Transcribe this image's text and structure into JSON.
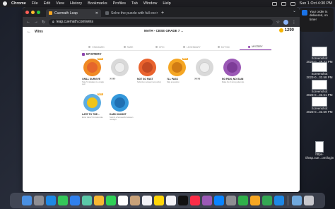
{
  "menubar": {
    "app_name": "Chrome",
    "items": [
      "File",
      "Edit",
      "View",
      "History",
      "Bookmarks",
      "Profiles",
      "Tab",
      "Window",
      "Help"
    ],
    "clock": "Sun 1 Oct  4:30 PM"
  },
  "browser": {
    "tabs": [
      {
        "title": "Cuemath Leap",
        "active": true,
        "favicon_color": "#f5a623"
      },
      {
        "title": "Solve the puzzle with full exc",
        "active": false,
        "favicon_color": "#5f6368"
      }
    ],
    "url": "leap.cuemath.com/wins"
  },
  "page": {
    "header_title": "Wins",
    "grade_selector": "MATH - CBSE GRADE 7",
    "coins": "1290",
    "category_tabs": [
      {
        "label": "STANDARD",
        "active": false
      },
      {
        "label": "RARE",
        "active": false
      },
      {
        "label": "EPIC",
        "active": false
      },
      {
        "label": "LEGENDARY",
        "active": false
      },
      {
        "label": "MYTHIC",
        "active": false
      },
      {
        "label": "MYSTERY",
        "active": true
      }
    ],
    "section_title": "MYSTERY",
    "badges": [
      {
        "name": "I WILL SURVIVE",
        "desc": "Take 5 mistakes in a single quiz",
        "unlocked": true,
        "new": true,
        "color": "#f08a24",
        "inner": "#e5662b"
      },
      {
        "name": "????",
        "desc": "",
        "unlocked": false,
        "new": false,
        "color": "#d9d9d9",
        "inner": "#eeeeee"
      },
      {
        "name": "NOT SO FAST",
        "desc": "Submit an answer too quickly",
        "unlocked": true,
        "new": false,
        "color": "#e9632e",
        "inner": "#c44a23"
      },
      {
        "name": "I'LL PASS",
        "desc": "Skip a question",
        "unlocked": true,
        "new": true,
        "color": "#f5a623",
        "inner": "#d17c14"
      },
      {
        "name": "????",
        "desc": "",
        "unlocked": false,
        "new": false,
        "color": "#d9d9d9",
        "inner": "#eeeeee"
      },
      {
        "name": "NO PAIN, NO GAIN",
        "desc": "Make the 3 wrong attempts",
        "unlocked": true,
        "new": false,
        "color": "#9b59b6",
        "inner": "#7d3c98"
      },
      {
        "name": "LATE TO THE...",
        "desc": "Enter class 5 minutes late",
        "unlocked": true,
        "new": true,
        "color": "#5dade2",
        "inner": "#f0c419"
      },
      {
        "name": "DARK KNIGHT",
        "desc": "Submit a homework between midnight",
        "unlocked": true,
        "new": false,
        "color": "#3498db",
        "inner": "#1f6fb2"
      }
    ]
  },
  "notification": {
    "line1": "Your order is",
    "line2": "delivered, on time!"
  },
  "desktop_files": [
    {
      "line1": "Screenshot",
      "line2": "2023-0...29.37 PM"
    },
    {
      "line1": "Screenshot",
      "line2": "2023-0...33.58 PM"
    },
    {
      "line1": "Screenshot",
      "line2": "2023-0...33.51 PM"
    },
    {
      "line1": "Screenshot",
      "line2": "2023-0...33.59 PM"
    },
    {
      "line1": "https-",
      "line2": "//leap.cue...om/login"
    }
  ],
  "dock": {
    "icons": [
      {
        "name": "finder-icon",
        "color": "#4a90e2"
      },
      {
        "name": "launchpad-icon",
        "color": "#8e8e93"
      },
      {
        "name": "safari-icon",
        "color": "#1e88e5"
      },
      {
        "name": "messages-icon",
        "color": "#34c759"
      },
      {
        "name": "mail-icon",
        "color": "#2f80ed"
      },
      {
        "name": "maps-icon",
        "color": "#5ac8a8"
      },
      {
        "name": "photos-icon",
        "color": "#f7b733"
      },
      {
        "name": "facetime-icon",
        "color": "#30d158"
      },
      {
        "name": "calendar-icon",
        "color": "#ffffff"
      },
      {
        "name": "contacts-icon",
        "color": "#c8a27a"
      },
      {
        "name": "reminders-icon",
        "color": "#f2f2f7"
      },
      {
        "name": "notes-icon",
        "color": "#ffd60a"
      },
      {
        "name": "freeform-icon",
        "color": "#f2f2f7"
      },
      {
        "name": "tv-icon",
        "color": "#111111"
      },
      {
        "name": "music-icon",
        "color": "#fa2d48"
      },
      {
        "name": "podcasts-icon",
        "color": "#9b59b6"
      },
      {
        "name": "appstore-icon",
        "color": "#0a84ff"
      },
      {
        "name": "settings-icon",
        "color": "#8e8e93"
      },
      {
        "name": "numbers-icon",
        "color": "#30b04a"
      },
      {
        "name": "pages-icon",
        "color": "#f5a623"
      },
      {
        "name": "chrome-icon",
        "color": "#34a853"
      },
      {
        "name": "vscode-icon",
        "color": "#1e88e5"
      },
      {
        "name": "downloads-icon",
        "color": "#6fa8dc"
      },
      {
        "name": "trash-icon",
        "color": "#c7c7cc"
      }
    ]
  }
}
